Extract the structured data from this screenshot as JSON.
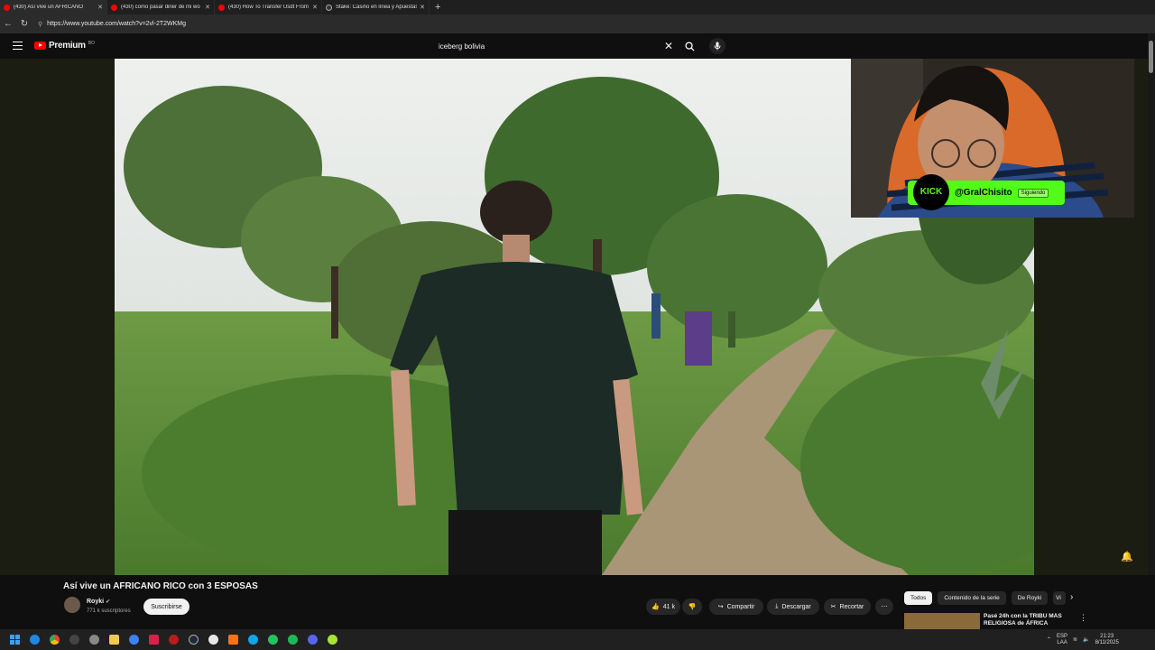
{
  "tabs": [
    {
      "title": "(430) Así vive un AFRICANO",
      "active": true
    },
    {
      "title": "(430) como pasar diner de mi wo",
      "active": false
    },
    {
      "title": "(430) How To Transfer Usdt From",
      "active": false
    },
    {
      "title": "Stake: Casino en línea y Apuestas",
      "active": false
    }
  ],
  "browser": {
    "url": "https://www.youtube.com/watch?v=2vl-2T2WKMg"
  },
  "youtube": {
    "brand": "Premium",
    "country": "BO",
    "search_value": "iceberg bolivia"
  },
  "overlay": {
    "kick_logo": "KICK",
    "kick_user": "@GralChisito",
    "follow_label": "Siguiendo"
  },
  "video": {
    "title": "Así vive un AFRICANO RICO con 3 ESPOSAS",
    "channel": "Royki",
    "subscribers": "771 k suscriptores",
    "subscribe_label": "Suscribirse",
    "likes": "41 k",
    "share_label": "Compartir",
    "download_label": "Descargar",
    "clip_label": "Recortar"
  },
  "chips": [
    "Todos",
    "Contenido de la serie",
    "De Royki",
    "Vi"
  ],
  "recommended": {
    "title": "Pasé 24h con la TRIBU MÁS RELIGIOSA de ÁFRICA"
  },
  "tray": {
    "lang_top": "ESP",
    "lang_bottom": "LAA",
    "time": "21:23",
    "date": "8/11/2025"
  },
  "colors": {
    "kick_green": "#53fc18",
    "youtube_red": "#ff0000"
  }
}
